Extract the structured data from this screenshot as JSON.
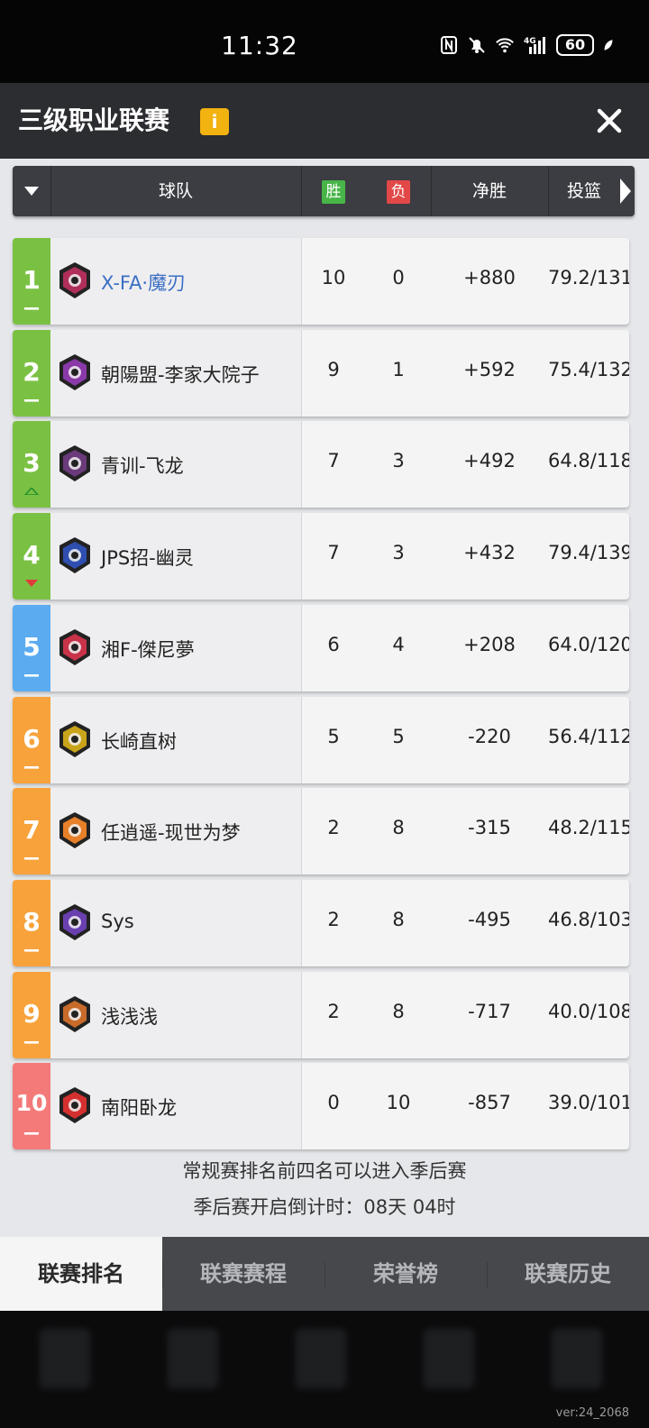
{
  "status_bar": {
    "time": "11:32",
    "signal": "4G",
    "battery": "60"
  },
  "header": {
    "title": "三级职业联赛",
    "info_label": "i"
  },
  "columns": {
    "team": "球队",
    "win": "胜",
    "loss": "负",
    "net": "净胜",
    "shooting": "投篮"
  },
  "rows": [
    {
      "rank": "1",
      "team": "X-FA·魔刃",
      "w": "10",
      "l": "0",
      "net": "+880",
      "extra": "79.2/131",
      "trend": "none",
      "rank_color": "#7ac143",
      "highlight": true,
      "logo_color": "#b02f5a"
    },
    {
      "rank": "2",
      "team": "朝陽盟-李家大院子",
      "w": "9",
      "l": "1",
      "net": "+592",
      "extra": "75.4/132",
      "trend": "none",
      "rank_color": "#7ac143",
      "highlight": false,
      "logo_color": "#8a3aa8"
    },
    {
      "rank": "3",
      "team": "青训-飞龙",
      "w": "7",
      "l": "3",
      "net": "+492",
      "extra": "64.8/118",
      "trend": "up",
      "rank_color": "#7ac143",
      "highlight": false,
      "logo_color": "#6a3a7a"
    },
    {
      "rank": "4",
      "team": "JPS招-幽灵",
      "w": "7",
      "l": "3",
      "net": "+432",
      "extra": "79.4/139",
      "trend": "down",
      "rank_color": "#7ac143",
      "highlight": false,
      "logo_color": "#2f4fb0"
    },
    {
      "rank": "5",
      "team": "湘F-傑尼夢",
      "w": "6",
      "l": "4",
      "net": "+208",
      "extra": "64.0/120",
      "trend": "none",
      "rank_color": "#5aabf0",
      "highlight": false,
      "logo_color": "#c8334a"
    },
    {
      "rank": "6",
      "team": "长崎直树",
      "w": "5",
      "l": "5",
      "net": "-220",
      "extra": "56.4/112",
      "trend": "none",
      "rank_color": "#f7a23b",
      "highlight": false,
      "logo_color": "#c9a41a"
    },
    {
      "rank": "7",
      "team": "任逍遥-现世为梦",
      "w": "2",
      "l": "8",
      "net": "-315",
      "extra": "48.2/115",
      "trend": "none",
      "rank_color": "#f7a23b",
      "highlight": false,
      "logo_color": "#e8802a"
    },
    {
      "rank": "8",
      "team": "Sys",
      "w": "2",
      "l": "8",
      "net": "-495",
      "extra": "46.8/103",
      "trend": "none",
      "rank_color": "#f7a23b",
      "highlight": false,
      "logo_color": "#6a40b0"
    },
    {
      "rank": "9",
      "team": "浅浅浅",
      "w": "2",
      "l": "8",
      "net": "-717",
      "extra": "40.0/108",
      "trend": "none",
      "rank_color": "#f7a23b",
      "highlight": false,
      "logo_color": "#c86a2a"
    },
    {
      "rank": "10",
      "team": "南阳卧龙",
      "w": "0",
      "l": "10",
      "net": "-857",
      "extra": "39.0/101",
      "trend": "none",
      "rank_color": "#f47a7a",
      "highlight": false,
      "logo_color": "#d43030"
    }
  ],
  "notes": {
    "line1": "常规赛排名前四名可以进入季后赛",
    "line2": "季后赛开启倒计时：08天 04时"
  },
  "tabs": [
    "联赛排名",
    "联赛赛程",
    "荣誉榜",
    "联赛历史"
  ],
  "version": "ver:24_2068"
}
